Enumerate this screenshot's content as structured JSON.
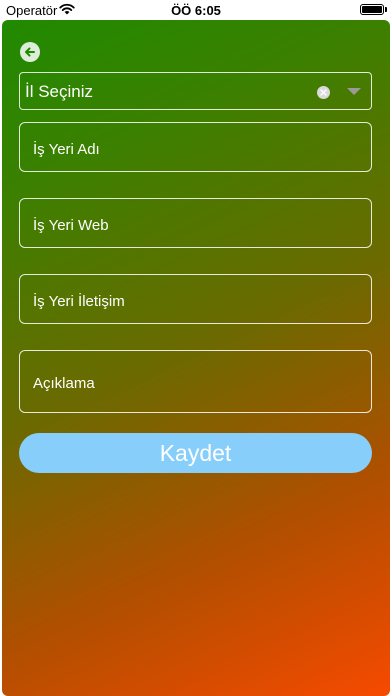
{
  "status_bar": {
    "carrier": "Operatör",
    "time": "ÖÖ 6:05",
    "battery_level": 1.0
  },
  "back": {
    "icon": "arrow-left-icon"
  },
  "city_select": {
    "value": "İl Seçiniz",
    "clear_icon": "clear-circle-icon",
    "dropdown_icon": "chevron-down-icon"
  },
  "form": {
    "business_name_placeholder": "İş Yeri Adı",
    "business_web_placeholder": "İş Yeri Web",
    "business_contact_placeholder": "İş Yeri İletişim",
    "description_placeholder": "Açıklama"
  },
  "save_button": {
    "label": "Kaydet",
    "color": "#87cefa"
  },
  "colors": {
    "gradient_start": "#1f8a00",
    "gradient_end": "#f64a00"
  }
}
